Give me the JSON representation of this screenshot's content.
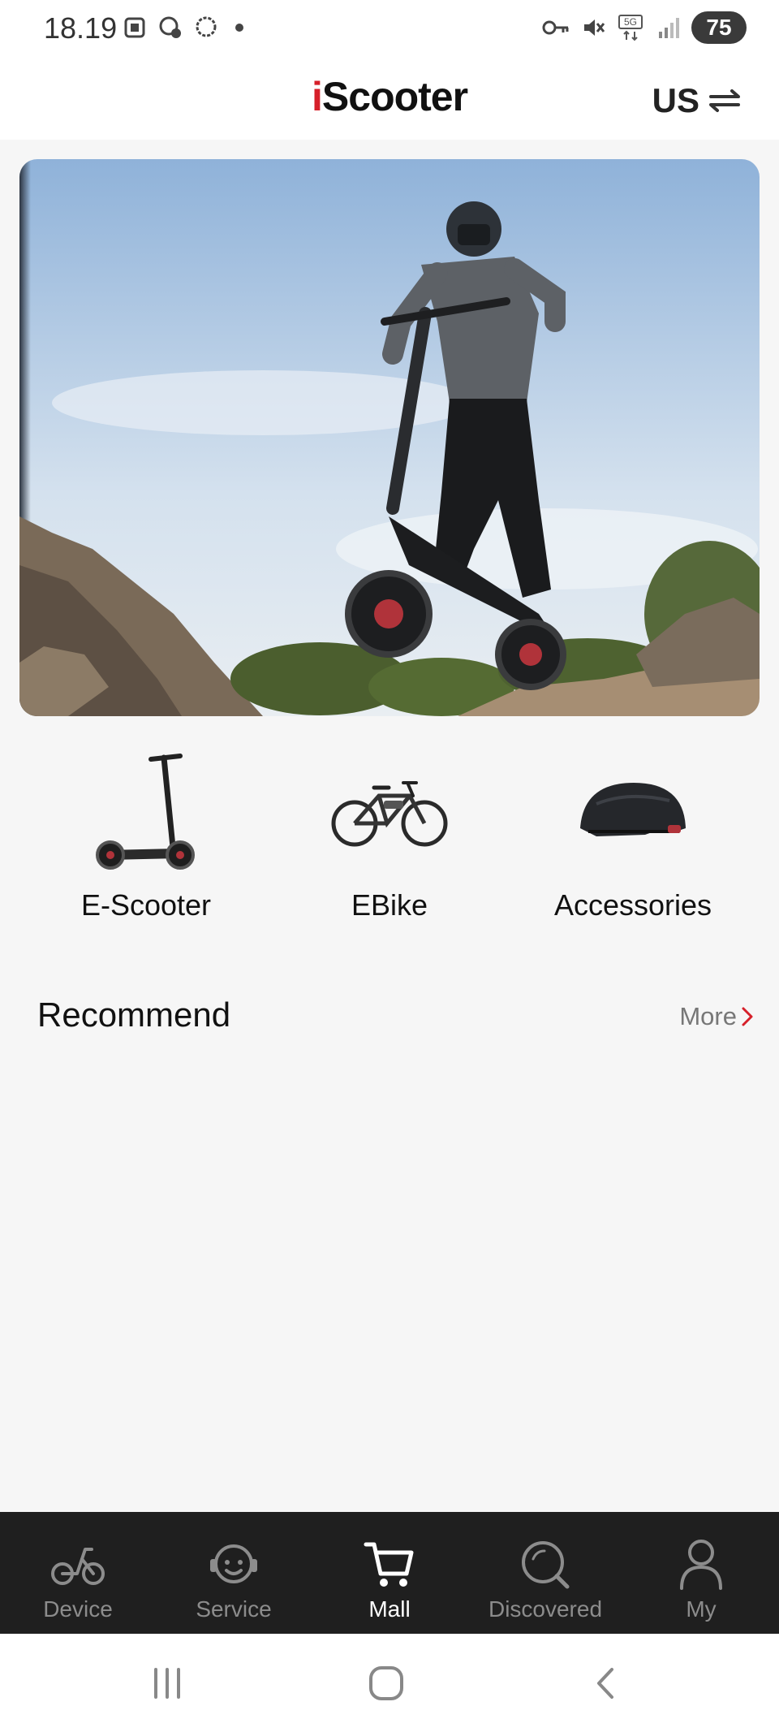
{
  "status_bar": {
    "time": "18.19",
    "battery": "75",
    "network": "5G"
  },
  "header": {
    "logo_i": "i",
    "logo_rest": "Scooter",
    "region": "US"
  },
  "categories": [
    {
      "label": "E-Scooter",
      "icon": "e-scooter-image"
    },
    {
      "label": "EBike",
      "icon": "ebike-image"
    },
    {
      "label": "Accessories",
      "icon": "helmet-image"
    }
  ],
  "recommend": {
    "title": "Recommend",
    "more_label": "More"
  },
  "bottom_nav": [
    {
      "label": "Device",
      "icon": "bike-icon",
      "active": false
    },
    {
      "label": "Service",
      "icon": "support-agent-icon",
      "active": false
    },
    {
      "label": "Mall",
      "icon": "cart-icon",
      "active": true
    },
    {
      "label": "Discovered",
      "icon": "search-icon",
      "active": false
    },
    {
      "label": "My",
      "icon": "user-icon",
      "active": false
    }
  ],
  "colors": {
    "brand_red": "#d6202a",
    "nav_bg": "#1f1f1f",
    "page_bg": "#f6f6f6"
  }
}
